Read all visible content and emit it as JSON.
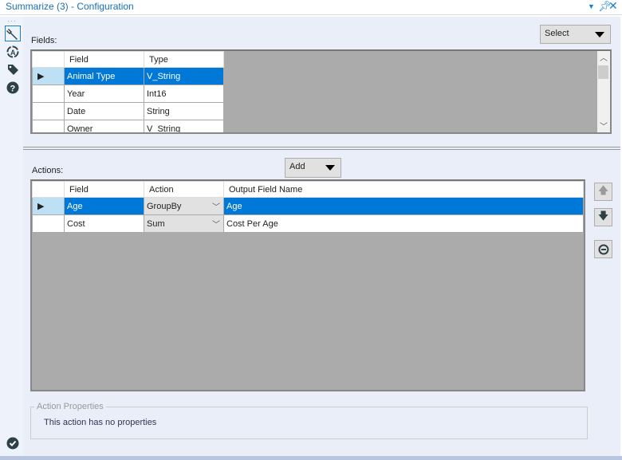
{
  "window": {
    "title": "Summarize (3) - Configuration"
  },
  "fields": {
    "label": "Fields:",
    "select_label": "Select",
    "columns": [
      "Field",
      "Type"
    ],
    "rows": [
      {
        "field": "Animal Type",
        "type": "V_String"
      },
      {
        "field": "Year",
        "type": "Int16"
      },
      {
        "field": "Date",
        "type": "String"
      },
      {
        "field": "Owner",
        "type": "V_String"
      }
    ]
  },
  "actions": {
    "label": "Actions:",
    "add_label": "Add",
    "columns": [
      "Field",
      "Action",
      "Output Field Name"
    ],
    "rows": [
      {
        "field": "Age",
        "action": "GroupBy",
        "output": "Age"
      },
      {
        "field": "Cost",
        "action": "Sum",
        "output": "Cost Per Age"
      }
    ]
  },
  "properties": {
    "legend": "Action Properties",
    "text": "This action has no properties"
  },
  "colors": {
    "accent": "#0078d7",
    "panel": "#e9eef8",
    "grid_bg": "#ababab"
  }
}
